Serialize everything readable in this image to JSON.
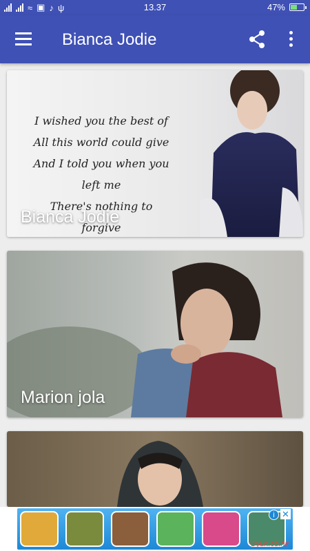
{
  "status_bar": {
    "time": "13.37",
    "battery": "47%",
    "battery_level": 0.47
  },
  "app_bar": {
    "title": "Bianca Jodie",
    "icons": [
      "menu-icon",
      "share-icon",
      "more-vert-icon"
    ]
  },
  "cards": [
    {
      "caption": "Bianca Jodie",
      "poem": [
        "I wished you the best of",
        "All this world could give",
        "And I told you when you left me",
        "There's nothing to forgive"
      ]
    },
    {
      "caption": "Marion jola"
    },
    {
      "caption": ""
    }
  ],
  "ad": {
    "brand": "Oyun.co.nz",
    "info_icon": "info-icon",
    "close_icon": "close-icon"
  },
  "colors": {
    "primary": "#3f51b5",
    "background": "#ededed"
  }
}
